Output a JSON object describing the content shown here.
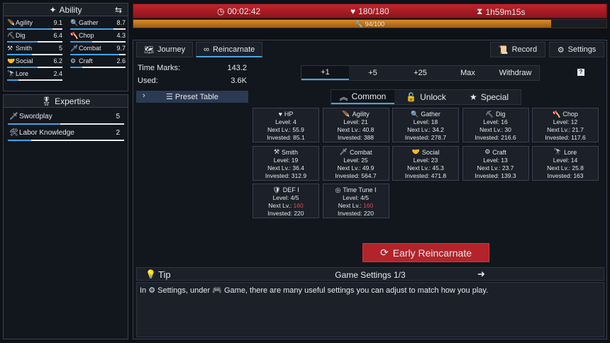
{
  "ability": {
    "title": "Ability",
    "items": [
      {
        "name": "Agility",
        "value": "9.1",
        "icon": "feather-icon",
        "glyph": "🪶",
        "fill": 0.82
      },
      {
        "name": "Gather",
        "value": "8.7",
        "icon": "magnifier-icon",
        "glyph": "🔍",
        "fill": 0.78
      },
      {
        "name": "Dig",
        "value": "6.4",
        "icon": "pickaxe-icon",
        "glyph": "⛏",
        "fill": 0.55
      },
      {
        "name": "Chop",
        "value": "4.3",
        "icon": "axe-icon",
        "glyph": "🪓",
        "fill": 0.4
      },
      {
        "name": "Smith",
        "value": "5",
        "icon": "hammer-icon",
        "glyph": "⚒",
        "fill": 0.45
      },
      {
        "name": "Combat",
        "value": "9.7",
        "icon": "sword-icon",
        "glyph": "🗡",
        "fill": 0.88
      },
      {
        "name": "Social",
        "value": "6.2",
        "icon": "handshake-icon",
        "glyph": "🤝",
        "fill": 0.55
      },
      {
        "name": "Craft",
        "value": "2.6",
        "icon": "gears-icon",
        "glyph": "⚙",
        "fill": 0.22
      },
      {
        "name": "Lore",
        "value": "2.4",
        "icon": "binoculars-icon",
        "glyph": "🔭",
        "fill": 0.2
      }
    ]
  },
  "expertise": {
    "title": "Expertise",
    "items": [
      {
        "name": "Swordplay",
        "value": "5",
        "icon": "sword-icon",
        "glyph": "🗡",
        "fill": 0.45
      },
      {
        "name": "Labor Knowledge",
        "value": "2",
        "icon": "tools-icon",
        "glyph": "🛠",
        "fill": 0.2
      }
    ]
  },
  "status": {
    "time": "00:02:42",
    "hp": "180/180",
    "remaining": "1h59m15s",
    "xp": "94/100",
    "xp_fraction": 0.94
  },
  "tabs": {
    "journey": "Journey",
    "reincarnate": "Reincarnate",
    "record": "Record",
    "settings": "Settings"
  },
  "marks": {
    "time_label": "Time Marks:",
    "time_value": "143.2",
    "used_label": "Used:",
    "used_value": "3.6K",
    "preset": "Preset Table"
  },
  "amounts": [
    "+1",
    "+5",
    "+25",
    "Max",
    "Withdraw"
  ],
  "categories": {
    "common": "Common",
    "unlock": "Unlock",
    "special": "Special"
  },
  "help": "?",
  "cards": [
    {
      "title": "HP",
      "icon": "heart-icon",
      "glyph": "♥",
      "level": "Level: 4",
      "next_prefix": "Next Lv.: ",
      "next": "55.9",
      "invested": "Invested: 85.1",
      "next_red": false
    },
    {
      "title": "Agility",
      "icon": "feather-icon",
      "glyph": "🪶",
      "level": "Level: 21",
      "next_prefix": "Next Lv.: ",
      "next": "40.8",
      "invested": "Invested: 388",
      "next_red": false
    },
    {
      "title": "Gather",
      "icon": "magnifier-icon",
      "glyph": "🔍",
      "level": "Level: 18",
      "next_prefix": "Next Lv.: ",
      "next": "34.2",
      "invested": "Invested: 278.7",
      "next_red": false
    },
    {
      "title": "Dig",
      "icon": "pickaxe-icon",
      "glyph": "⛏",
      "level": "Level: 16",
      "next_prefix": "Next Lv.: ",
      "next": "30",
      "invested": "Invested: 216.6",
      "next_red": false
    },
    {
      "title": "Chop",
      "icon": "axe-icon",
      "glyph": "🪓",
      "level": "Level: 12",
      "next_prefix": "Next Lv.: ",
      "next": "21.7",
      "invested": "Invested: 117.6",
      "next_red": false
    },
    {
      "title": "Smith",
      "icon": "hammer-icon",
      "glyph": "⚒",
      "level": "Level: 19",
      "next_prefix": "Next Lv.: ",
      "next": "36.4",
      "invested": "Invested: 312.9",
      "next_red": false
    },
    {
      "title": "Combat",
      "icon": "sword-icon",
      "glyph": "🗡",
      "level": "Level: 25",
      "next_prefix": "Next Lv.: ",
      "next": "49.9",
      "invested": "Invested: 564.7",
      "next_red": false
    },
    {
      "title": "Social",
      "icon": "handshake-icon",
      "glyph": "🤝",
      "level": "Level: 23",
      "next_prefix": "Next Lv.: ",
      "next": "45.3",
      "invested": "Invested: 471.8",
      "next_red": false
    },
    {
      "title": "Craft",
      "icon": "gears-icon",
      "glyph": "⚙",
      "level": "Level: 13",
      "next_prefix": "Next Lv.: ",
      "next": "23.7",
      "invested": "Invested: 139.3",
      "next_red": false
    },
    {
      "title": "Lore",
      "icon": "binoculars-icon",
      "glyph": "🔭",
      "level": "Level: 14",
      "next_prefix": "Next Lv.: ",
      "next": "25.8",
      "invested": "Invested: 163",
      "next_red": false
    },
    {
      "title": "DEF I",
      "icon": "shield-icon",
      "glyph": "🛡",
      "level": "Level: 4/5",
      "next_prefix": "Next Lv.: ",
      "next": "160",
      "invested": "Invested: 220",
      "next_red": true
    },
    {
      "title": "Time Tune I",
      "icon": "spiral-icon",
      "glyph": "◎",
      "level": "Level: 4/5",
      "next_prefix": "Next Lv.: ",
      "next": "160",
      "invested": "Invested: 220",
      "next_red": true
    }
  ],
  "early_reincarnate": "Early Reincarnate",
  "tip": {
    "label": "Tip",
    "title": "Game Settings 1/3",
    "text_1": "In ",
    "text_2": " Settings, under ",
    "text_3": " Game, there are many useful settings you can adjust to match how you play."
  },
  "colors": {
    "accent": "#4aa3df",
    "hp_bar": "#c0232b",
    "xp_bar": "#d98c28",
    "button_red": "#b3242a"
  }
}
